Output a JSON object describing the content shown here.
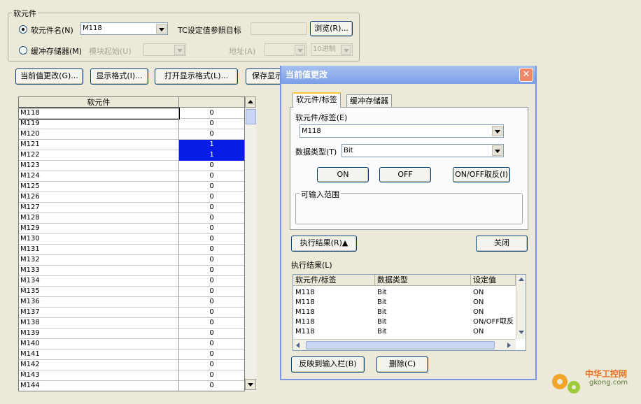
{
  "device_group": {
    "title": "软元件",
    "radio_device_label": "软元件名(N)",
    "device_value": "M118",
    "tc_label": "TC设定值参照目标",
    "browse_label": "浏览(R)...",
    "radio_buffer_label": "缓冲存储器(M)",
    "module_start_label": "模块起始(U)",
    "address_label": "地址(A)",
    "radix_value": "10进制"
  },
  "toolbar": {
    "change_value_label": "当前值更改(G)...",
    "display_format_label": "显示格式(I)...",
    "open_display_format_label": "打开显示格式(L)...",
    "save_display_label": "保存显示"
  },
  "device_table": {
    "header_device": "软元件",
    "header_value": "",
    "rows": [
      {
        "device": "M118",
        "value": "0"
      },
      {
        "device": "M119",
        "value": "0"
      },
      {
        "device": "M120",
        "value": "0"
      },
      {
        "device": "M121",
        "value": "1"
      },
      {
        "device": "M122",
        "value": "1"
      },
      {
        "device": "M123",
        "value": "0"
      },
      {
        "device": "M124",
        "value": "0"
      },
      {
        "device": "M125",
        "value": "0"
      },
      {
        "device": "M126",
        "value": "0"
      },
      {
        "device": "M127",
        "value": "0"
      },
      {
        "device": "M128",
        "value": "0"
      },
      {
        "device": "M129",
        "value": "0"
      },
      {
        "device": "M130",
        "value": "0"
      },
      {
        "device": "M131",
        "value": "0"
      },
      {
        "device": "M132",
        "value": "0"
      },
      {
        "device": "M133",
        "value": "0"
      },
      {
        "device": "M134",
        "value": "0"
      },
      {
        "device": "M135",
        "value": "0"
      },
      {
        "device": "M136",
        "value": "0"
      },
      {
        "device": "M137",
        "value": "0"
      },
      {
        "device": "M138",
        "value": "0"
      },
      {
        "device": "M139",
        "value": "0"
      },
      {
        "device": "M140",
        "value": "0"
      },
      {
        "device": "M141",
        "value": "0"
      },
      {
        "device": "M142",
        "value": "0"
      },
      {
        "device": "M143",
        "value": "0"
      },
      {
        "device": "M144",
        "value": "0"
      }
    ]
  },
  "dialog": {
    "title": "当前值更改",
    "tab_device": "软元件/标签",
    "tab_buffer": "缓冲存储器",
    "device_label": "软元件/标签(E)",
    "device_value": "M118",
    "datatype_label": "数据类型(T)",
    "datatype_value": "Bit",
    "on_label": "ON",
    "off_label": "OFF",
    "toggle_label": "ON/OFF取反(I)",
    "range_label": "可输入范围",
    "exec_result_button": "执行结果(R)▲",
    "close_label": "关闭",
    "exec_result_label": "执行结果(L)",
    "result_headers": [
      "软元件/标签",
      "数据类型",
      "设定值"
    ],
    "results": [
      {
        "device": "M118",
        "type": "Bit",
        "value": "ON"
      },
      {
        "device": "M118",
        "type": "Bit",
        "value": "ON"
      },
      {
        "device": "M118",
        "type": "Bit",
        "value": "ON"
      },
      {
        "device": "M118",
        "type": "Bit",
        "value": "ON/OFF取反"
      },
      {
        "device": "M118",
        "type": "Bit",
        "value": "ON"
      }
    ],
    "reflect_label": "反映到输入栏(B)",
    "delete_label": "删除(C)"
  },
  "watermark": {
    "brand": "中华工控网",
    "domain": "gkong.com"
  },
  "colors": {
    "highlight": "#0a1de6",
    "title_bar": "#7b9fe8"
  }
}
